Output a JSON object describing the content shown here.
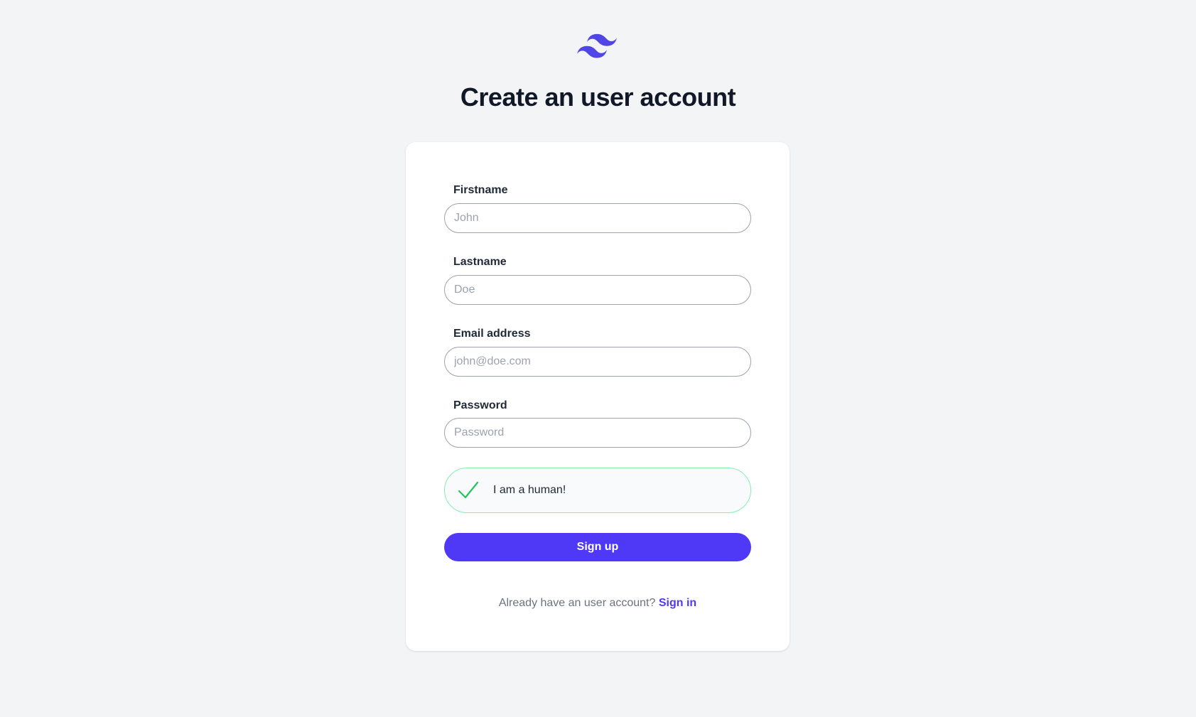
{
  "header": {
    "logo_icon": "tailwind-logo-icon",
    "title": "Create an user account"
  },
  "colors": {
    "accent": "#4f39f6",
    "success": "#22c55e",
    "background": "#f3f4f6",
    "text": "#111827"
  },
  "form": {
    "firstname": {
      "label": "Firstname",
      "placeholder": "John",
      "value": ""
    },
    "lastname": {
      "label": "Lastname",
      "placeholder": "Doe",
      "value": ""
    },
    "email": {
      "label": "Email address",
      "placeholder": "john@doe.com",
      "value": ""
    },
    "password": {
      "label": "Password",
      "placeholder": "Password",
      "value": ""
    },
    "captcha": {
      "icon": "checkmark-icon",
      "label": "I am a human!",
      "checked": true
    },
    "submit_label": "Sign up"
  },
  "footer": {
    "prompt": "Already have an user account?",
    "link_label": "Sign in"
  }
}
